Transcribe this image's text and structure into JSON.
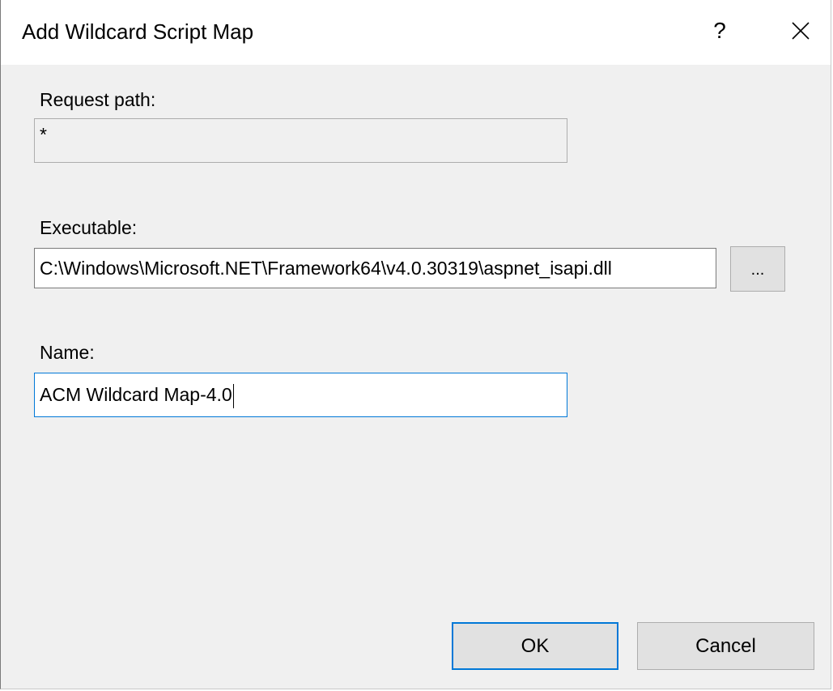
{
  "window": {
    "title": "Add Wildcard Script Map",
    "help_label": "?",
    "close_icon": "close-icon"
  },
  "form": {
    "request_path": {
      "label": "Request path:",
      "value": "*"
    },
    "executable": {
      "label": "Executable:",
      "value": "C:\\Windows\\Microsoft.NET\\Framework64\\v4.0.30319\\aspnet_isapi.dll",
      "browse_label": "..."
    },
    "name": {
      "label": "Name:",
      "value": "ACM Wildcard Map-4.0"
    }
  },
  "buttons": {
    "ok_label": "OK",
    "cancel_label": "Cancel"
  },
  "colors": {
    "focus_accent": "#0078d7",
    "dialog_background": "#f0f0f0",
    "button_face": "#e1e1e1"
  }
}
